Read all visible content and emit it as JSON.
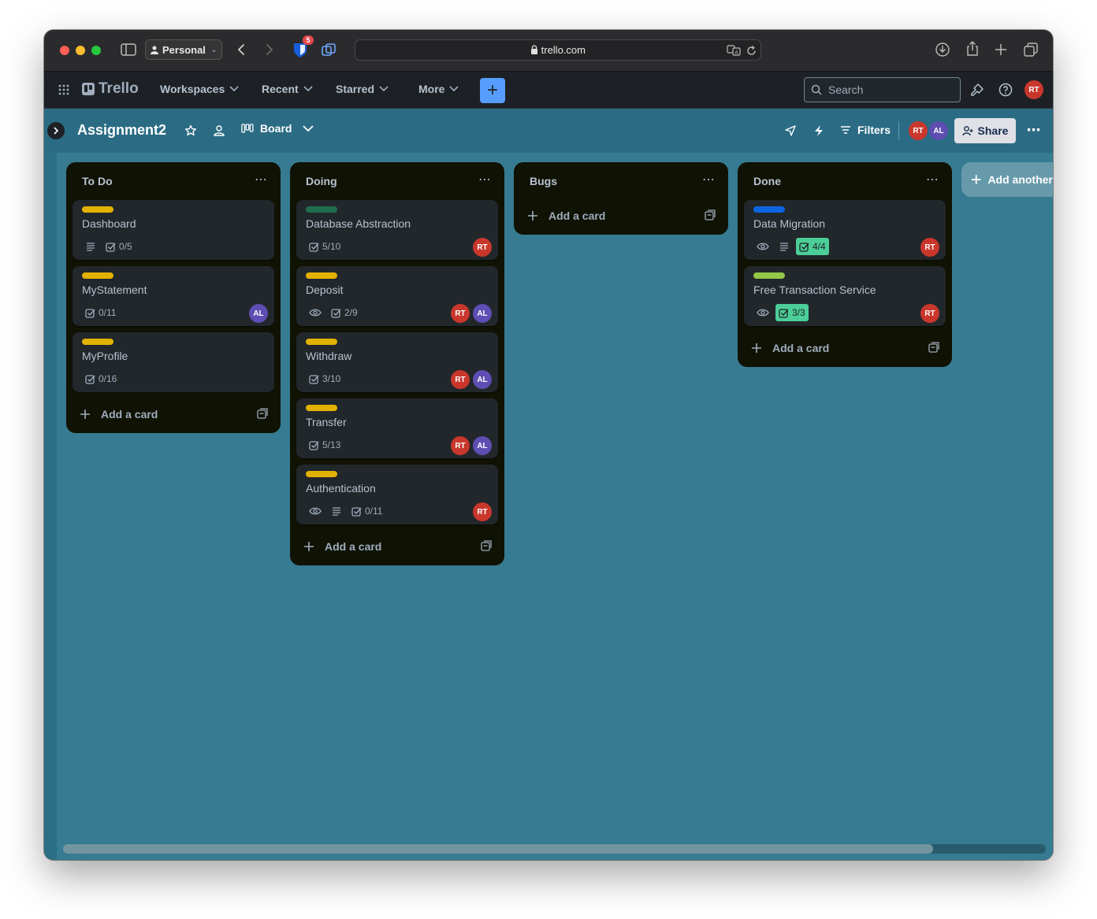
{
  "browser": {
    "profile_label": "Personal",
    "url": "trello.com",
    "extension_badge": "5"
  },
  "header": {
    "brand": "Trello",
    "nav": [
      {
        "label": "Workspaces"
      },
      {
        "label": "Recent"
      },
      {
        "label": "Starred"
      },
      {
        "label": "More"
      }
    ],
    "create_label": "+",
    "search_placeholder": "Search",
    "user_initials": "RT"
  },
  "board": {
    "title": "Assignment2",
    "view_label": "Board",
    "filters_label": "Filters",
    "share_label": "Share",
    "members": [
      "RT",
      "AL"
    ],
    "add_list_label": "Add another list",
    "scroll_fraction": 0.885
  },
  "colors": {
    "board_bg": "#367b91",
    "list_bg": "#101204",
    "card_bg": "#22272b",
    "label_yellow": "#e2b203",
    "label_green": "#216e4e",
    "label_blue": "#0c66e4",
    "label_lime": "#94c748",
    "avatar_rt": "#c9372c",
    "avatar_al": "#5e4db2",
    "checklist_done": "#4bce97"
  },
  "lists": [
    {
      "title": "To Do",
      "add_card_label": "Add a card",
      "cards": [
        {
          "title": "Dashboard",
          "label_color": "yellow",
          "watch": false,
          "desc": true,
          "checklist": "0/5",
          "complete": false,
          "members": []
        },
        {
          "title": "MyStatement",
          "label_color": "yellow",
          "watch": false,
          "desc": false,
          "checklist": "0/11",
          "complete": false,
          "members": [
            "AL"
          ]
        },
        {
          "title": "MyProfile",
          "label_color": "yellow",
          "watch": false,
          "desc": false,
          "checklist": "0/16",
          "complete": false,
          "members": []
        }
      ]
    },
    {
      "title": "Doing",
      "add_card_label": "Add a card",
      "cards": [
        {
          "title": "Database Abstraction",
          "label_color": "green",
          "watch": false,
          "desc": false,
          "checklist": "5/10",
          "complete": false,
          "members": [
            "RT"
          ]
        },
        {
          "title": "Deposit",
          "label_color": "yellow",
          "watch": true,
          "desc": false,
          "checklist": "2/9",
          "complete": false,
          "members": [
            "RT",
            "AL"
          ]
        },
        {
          "title": "Withdraw",
          "label_color": "yellow",
          "watch": false,
          "desc": false,
          "checklist": "3/10",
          "complete": false,
          "members": [
            "RT",
            "AL"
          ]
        },
        {
          "title": "Transfer",
          "label_color": "yellow",
          "watch": false,
          "desc": false,
          "checklist": "5/13",
          "complete": false,
          "members": [
            "RT",
            "AL"
          ]
        },
        {
          "title": "Authentication",
          "label_color": "yellow",
          "watch": true,
          "desc": true,
          "checklist": "0/11",
          "complete": false,
          "members": [
            "RT"
          ]
        }
      ]
    },
    {
      "title": "Bugs",
      "add_card_label": "Add a card",
      "cards": []
    },
    {
      "title": "Done",
      "add_card_label": "Add a card",
      "cards": [
        {
          "title": "Data Migration",
          "label_color": "blue",
          "watch": true,
          "desc": true,
          "checklist": "4/4",
          "complete": true,
          "members": [
            "RT"
          ]
        },
        {
          "title": "Free Transaction Service",
          "label_color": "lime",
          "watch": true,
          "desc": false,
          "checklist": "3/3",
          "complete": true,
          "members": [
            "RT"
          ]
        }
      ]
    }
  ]
}
